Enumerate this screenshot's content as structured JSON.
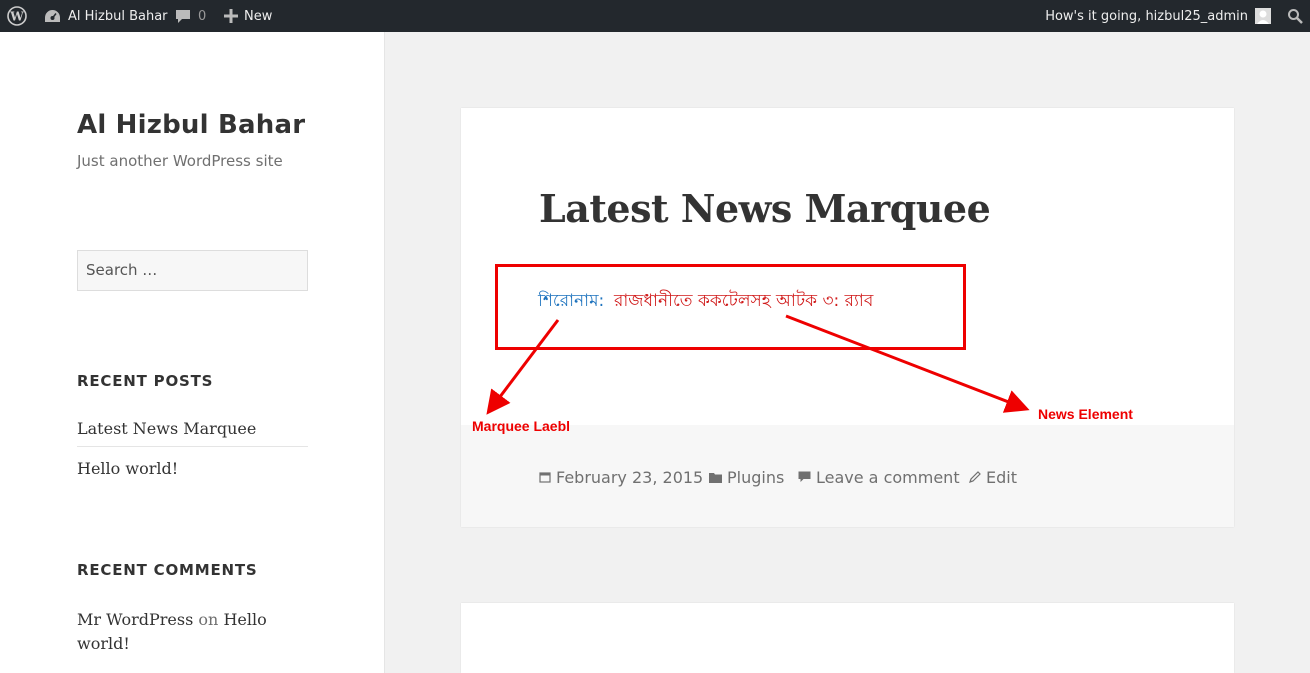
{
  "adminbar": {
    "site_name": "Al Hizbul Bahar",
    "comments_count": "0",
    "new_label": "New",
    "howdy": "How's it going, hizbul25_admin"
  },
  "sidebar": {
    "site_title": "Al Hizbul Bahar",
    "site_description": "Just another WordPress site",
    "search_placeholder": "Search …",
    "recent_posts_title": "RECENT POSTS",
    "recent_posts": [
      "Latest News Marquee",
      "Hello world!"
    ],
    "recent_comments_title": "RECENT COMMENTS",
    "recent_comment": {
      "author": "Mr WordPress",
      "on": "on",
      "post": "Hello world!"
    }
  },
  "article": {
    "title": "Latest News Marquee",
    "marquee_label": "শিরোনাম:",
    "marquee_news": "রাজধানীতে ককটেলসহ আটক ৩: র‍্যাব",
    "meta": {
      "date": "February 23, 2015",
      "category": "Plugins",
      "comment": "Leave a comment",
      "edit": "Edit"
    }
  },
  "annotations": {
    "label": "Marquee Laebl",
    "news": "News Element"
  },
  "colors": {
    "adminbar_bg": "#23282d",
    "annotation_red": "#e00000",
    "marquee_label": "#1e73be",
    "marquee_news": "#d01a1a"
  }
}
